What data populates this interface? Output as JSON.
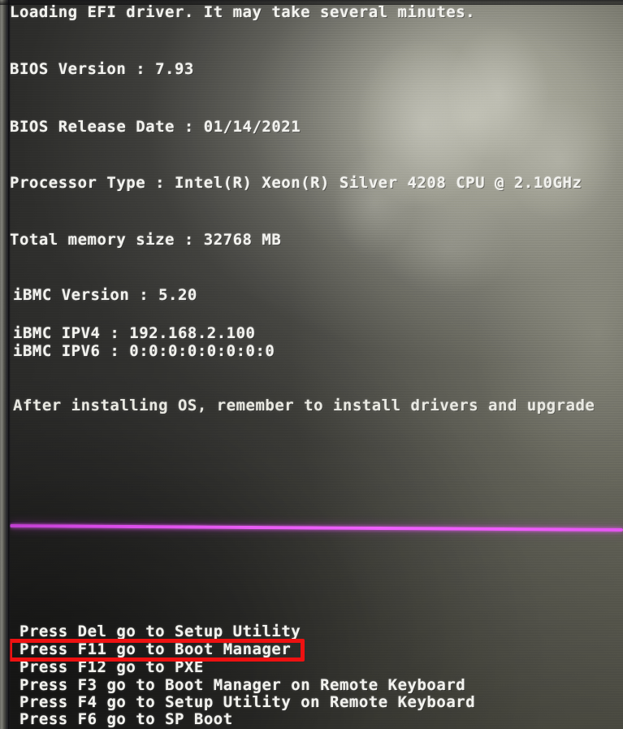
{
  "screen": {
    "kind": "bios-post-screen",
    "loading_message": "Loading EFI driver. It may take several minutes.",
    "info": [
      {
        "label": "BIOS Version",
        "value": "7.93",
        "text": "BIOS Version : 7.93"
      },
      {
        "label": "BIOS Release Date",
        "value": "01/14/2021",
        "text": "BIOS Release Date : 01/14/2021"
      },
      {
        "label": "Processor Type",
        "value": "Intel(R) Xeon(R) Silver 4208 CPU @ 2.10GHz",
        "text": "Processor Type : Intel(R) Xeon(R) Silver 4208 CPU @ 2.10GHz"
      },
      {
        "label": "Total memory size",
        "value": "32768 MB",
        "text": "Total memory size : 32768 MB"
      },
      {
        "label": "iBMC Version",
        "value": "5.20",
        "text": "iBMC Version : 5.20"
      },
      {
        "label": "iBMC IPV4",
        "value": "192.168.2.100",
        "text": "iBMC IPV4 : 192.168.2.100"
      },
      {
        "label": "iBMC IPV6",
        "value": "0:0:0:0:0:0:0:0",
        "text": "iBMC IPV6 : 0:0:0:0:0:0:0:0"
      }
    ],
    "notice": "After installing OS, remember to install drivers and upgrade",
    "boot_options": [
      {
        "key": "Del",
        "text": "Press Del go to Setup Utility",
        "highlighted": false
      },
      {
        "key": "F11",
        "text": "Press F11 go to Boot Manager",
        "highlighted": true
      },
      {
        "key": "F12",
        "text": "Press F12 go to PXE",
        "highlighted": false
      },
      {
        "key": "F3",
        "text": "Press F3 go to Boot Manager on Remote Keyboard",
        "highlighted": false
      },
      {
        "key": "F4",
        "text": "Press F4 go to Setup Utility on Remote Keyboard",
        "highlighted": false
      },
      {
        "key": "F6",
        "text": "Press F6 go to SP Boot",
        "highlighted": false
      }
    ]
  },
  "annotation": {
    "target_label": "Press F11 go to Boot Manager",
    "box_color": "#ee1111"
  },
  "decor": {
    "separator_color": "#ee5cf8",
    "text_color": "#f2f2ee",
    "background_color": "#33332f"
  }
}
